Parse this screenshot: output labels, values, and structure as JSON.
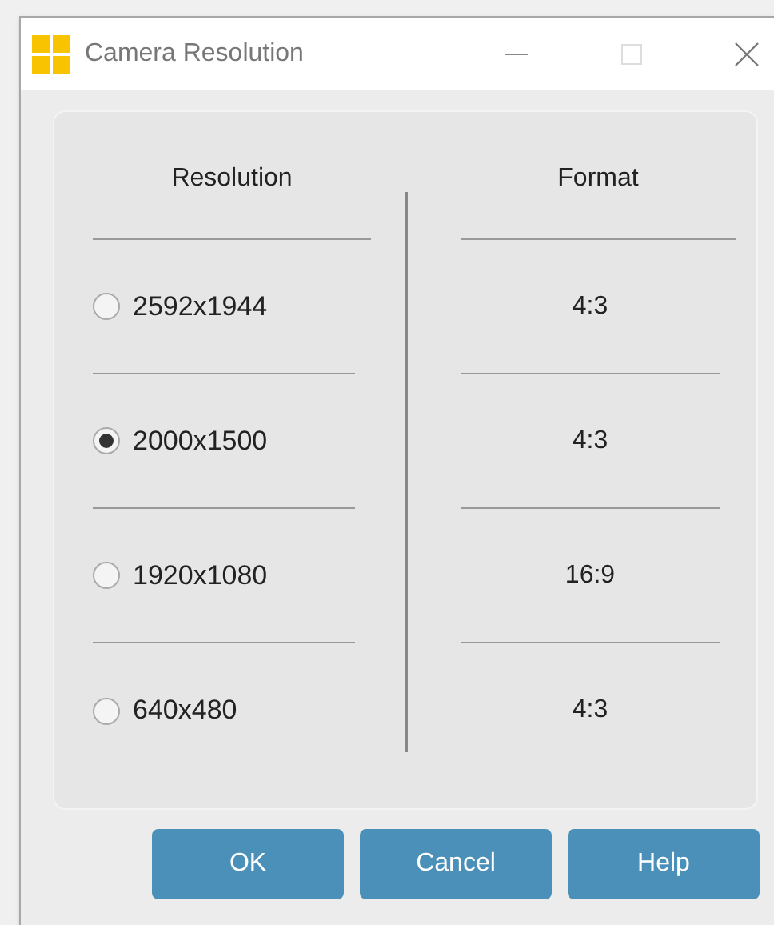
{
  "window": {
    "title": "Camera Resolution"
  },
  "columns": [
    "Resolution",
    "Format"
  ],
  "rows": [
    {
      "resolution": "2592x1944",
      "format": "4:3",
      "selected": false
    },
    {
      "resolution": "2000x1500",
      "format": "4:3",
      "selected": true
    },
    {
      "resolution": "1920x1080",
      "format": "16:9",
      "selected": false
    },
    {
      "resolution": "640x480",
      "format": "4:3",
      "selected": false
    }
  ],
  "buttons": [
    "OK",
    "Cancel",
    "Help"
  ]
}
